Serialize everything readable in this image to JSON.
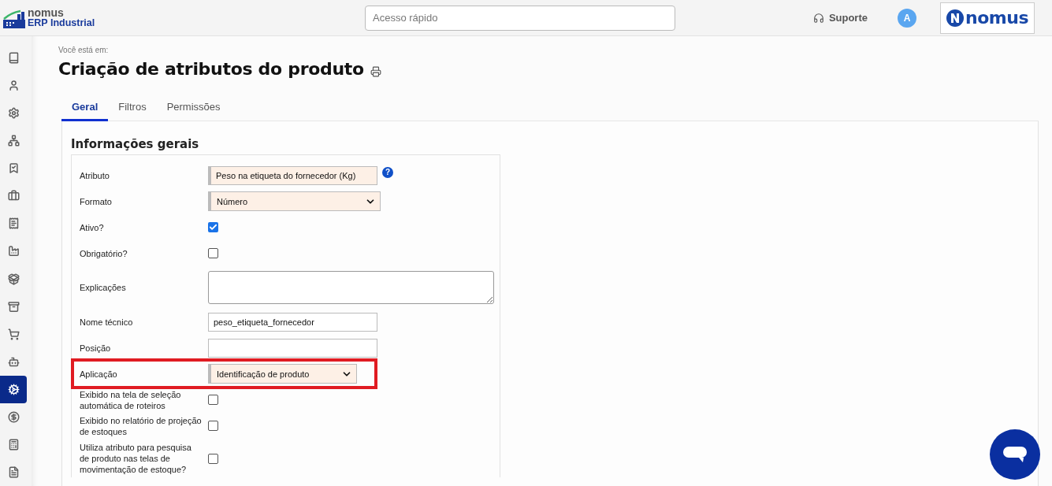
{
  "header": {
    "brand_name": "nomus",
    "brand_sub": "ERP Industrial",
    "search": {
      "placeholder": "Acesso rápido"
    },
    "support": "Suporte",
    "avatar": "A",
    "partner_logo": "nomus"
  },
  "sidebar": {
    "items": [
      {
        "selected": false
      },
      {
        "selected": false
      },
      {
        "selected": false
      },
      {
        "selected": false
      },
      {
        "selected": false
      },
      {
        "selected": false
      },
      {
        "selected": false
      },
      {
        "selected": false
      },
      {
        "selected": false
      },
      {
        "selected": false
      },
      {
        "selected": false
      },
      {
        "selected": false
      },
      {
        "selected": true
      },
      {
        "selected": false
      },
      {
        "selected": false
      },
      {
        "selected": false
      }
    ]
  },
  "breadcrumb": "Você está em:",
  "title": "Criação de atributos do produto",
  "tabs": [
    {
      "label": "Geral",
      "selected": true
    },
    {
      "label": "Filtros",
      "selected": false
    },
    {
      "label": "Permissões",
      "selected": false
    }
  ],
  "section": {
    "title": "Informações gerais",
    "fields": [
      {
        "kind": "text",
        "label": "Atributo",
        "value": "Peso na etiqueta do fornecedor (Kg)",
        "required": true,
        "help": "?",
        "highlighted": false
      },
      {
        "kind": "select",
        "label": "Formato",
        "value": "Número",
        "required": true,
        "highlighted": false
      },
      {
        "kind": "checkbox",
        "label": "Ativo?",
        "checked": true,
        "highlighted": false
      },
      {
        "kind": "checkbox",
        "label": "Obrigatório?",
        "checked": false,
        "highlighted": false
      },
      {
        "kind": "textarea",
        "label": "Explicações",
        "highlighted": false
      },
      {
        "kind": "text",
        "label": "Nome técnico",
        "value": "peso_etiqueta_fornecedor",
        "required": false,
        "highlighted": false
      },
      {
        "kind": "text",
        "label": "Posição",
        "required": false,
        "highlighted": false
      },
      {
        "kind": "select",
        "label": "Aplicação",
        "value": "Identificação de produto",
        "required": true,
        "highlighted": true
      },
      {
        "kind": "checkbox",
        "label": "Exibido na tela de seleção automática de roteiros",
        "checked": false,
        "highlighted": false
      },
      {
        "kind": "checkbox",
        "label": "Exibido no relatório de projeção de estoques",
        "checked": false,
        "highlighted": false
      },
      {
        "kind": "checkbox",
        "label": "Utiliza atributo para pesquisa de produto nas telas de movimentação de estoque?",
        "checked": false,
        "highlighted": false
      }
    ]
  }
}
